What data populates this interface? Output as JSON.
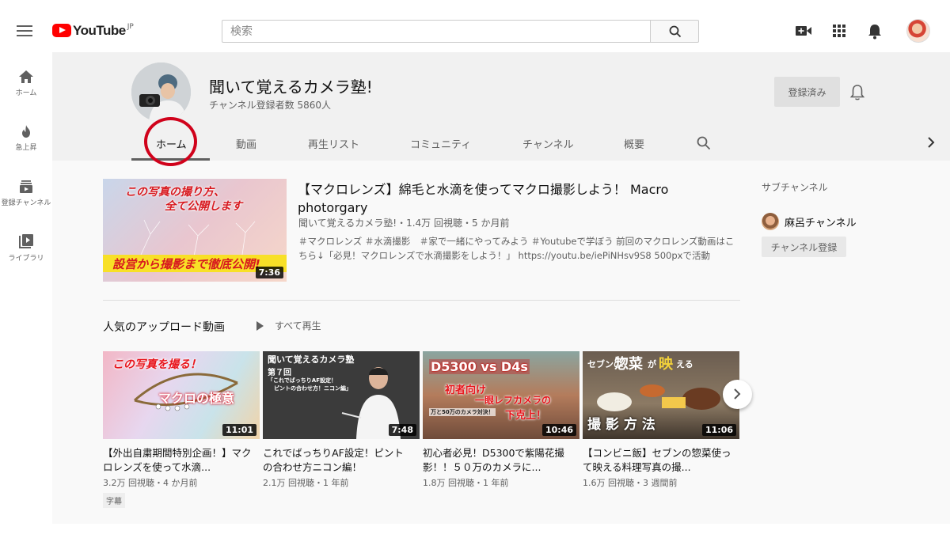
{
  "topbar": {
    "logo_text": "YouTube",
    "logo_country": "JP",
    "search_placeholder": "検索"
  },
  "sidebar": {
    "items": [
      {
        "label": "ホーム",
        "icon": "home-icon"
      },
      {
        "label": "急上昇",
        "icon": "flame-icon"
      },
      {
        "label": "登録チャンネル",
        "icon": "subscriptions-icon"
      },
      {
        "label": "ライブラリ",
        "icon": "library-icon"
      }
    ]
  },
  "channel": {
    "name": "聞いて覚えるカメラ塾!",
    "subscribers": "チャンネル登録者数 5860人",
    "subscribed_label": "登録済み"
  },
  "tabs": [
    "ホーム",
    "動画",
    "再生リスト",
    "コミュニティ",
    "チャンネル",
    "概要"
  ],
  "featured": {
    "thumb_line1": "この写真の撮り方、",
    "thumb_line2": "全て公開します",
    "thumb_banner": "設営から撮影まで徹底公開!",
    "duration": "7:36",
    "title": "【マクロレンズ】綿毛と水滴を使ってマクロ撮影しよう！ Macro photorgary",
    "meta": "聞いて覚えるカメラ塾!・1.4万 回視聴・5 か月前",
    "description": "＃マクロレンズ ＃水滴撮影　＃家で一緒にやってみよう ＃Youtubeで学ぼう 前回のマクロレンズ動画はこちら↓「必見！マクロレンズで水滴撮影をしよう！」 https://youtu.be/iePiNHsv9S8 500pxで活動"
  },
  "popular": {
    "title": "人気のアップロード動画",
    "play_all": "すべて再生",
    "videos": [
      {
        "thumb_texts": [
          "この写真を撮る！",
          "マクロの極意"
        ],
        "duration": "11:01",
        "title": "【外出自粛期間特別企画！】マクロレンズを使って水滴...",
        "meta": "3.2万 回視聴・4 か月前",
        "badge": "字幕"
      },
      {
        "thumb_texts": [
          "聞いて覚えるカメラ塾",
          "第７回",
          "「これでばっちりAF設定！",
          "ピントの合わせ方！ニコン編」"
        ],
        "duration": "7:48",
        "title": "これでばっちりAF設定！ピントの合わせ方ニコン編！",
        "meta": "2.1万 回視聴・1 年前",
        "badge": ""
      },
      {
        "thumb_texts": [
          "D5300 vs D4s",
          "初者向け",
          "一眼レフカメラの",
          "下克上！",
          "万と50万のカメラ対決！"
        ],
        "duration": "10:46",
        "title": "初心者必見！D5300で紫陽花撮影！！５０万のカメラに...",
        "meta": "1.8万 回視聴・1 年前",
        "badge": ""
      },
      {
        "thumb_texts": [
          "セブンの",
          "惣菜",
          "が",
          "映",
          "える",
          "撮 影 方 法"
        ],
        "duration": "11:06",
        "title": "【コンビニ飯】セブンの惣菜使って映える料理写真の撮...",
        "meta": "1.6万 回視聴・3 週間前",
        "badge": ""
      }
    ]
  },
  "subchannels": {
    "title": "サブチャンネル",
    "items": [
      {
        "name": "麻呂チャンネル",
        "button": "チャンネル登録"
      }
    ]
  },
  "colors": {
    "brand_red": "#ff0000",
    "highlight_circle": "#d0021b",
    "header_bg": "#f1f1f1",
    "page_bg": "#f9f9f9"
  }
}
